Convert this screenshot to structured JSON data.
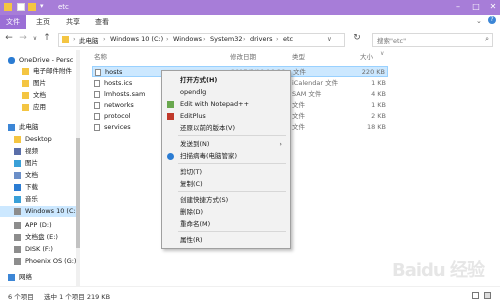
{
  "window": {
    "title": "etc"
  },
  "ribbon": {
    "tabs": [
      "文件",
      "主页",
      "共享",
      "查看"
    ]
  },
  "address": {
    "crumbs": [
      "此电脑",
      "Windows 10 (C:)",
      "Windows",
      "System32",
      "drivers",
      "etc"
    ],
    "search_placeholder": "搜索\"etc\""
  },
  "sidebar": {
    "items": [
      {
        "label": "OneDrive - Persc",
        "icon": "cloud-icon"
      },
      {
        "label": "电子邮件附件",
        "icon": "folder-icon"
      },
      {
        "label": "图片",
        "icon": "folder-icon"
      },
      {
        "label": "文档",
        "icon": "folder-icon"
      },
      {
        "label": "应用",
        "icon": "folder-icon"
      },
      {
        "label": "此电脑",
        "icon": "computer-icon"
      },
      {
        "label": "Desktop",
        "icon": "folder-icon"
      },
      {
        "label": "视频",
        "icon": "video-icon"
      },
      {
        "label": "图片",
        "icon": "image-icon"
      },
      {
        "label": "文档",
        "icon": "document-icon"
      },
      {
        "label": "下载",
        "icon": "download-icon"
      },
      {
        "label": "音乐",
        "icon": "music-icon"
      },
      {
        "label": "Windows 10 (C:)",
        "icon": "drive-icon"
      },
      {
        "label": "APP (D:)",
        "icon": "drive-icon"
      },
      {
        "label": "文档盘 (E:)",
        "icon": "drive-icon"
      },
      {
        "label": "DISK (F:)",
        "icon": "drive-icon"
      },
      {
        "label": "Phoenix OS (G:)",
        "icon": "drive-icon"
      },
      {
        "label": "网络",
        "icon": "network-icon"
      }
    ]
  },
  "columns": {
    "name": "名称",
    "date": "修改日期",
    "type": "类型",
    "size": "大小"
  },
  "files": [
    {
      "name": "hosts",
      "date": "2017/5/19 16:36",
      "type": "文件",
      "size": "220 KB"
    },
    {
      "name": "hosts.ics",
      "date": "",
      "type": "iCalendar 文件",
      "size": "1 KB"
    },
    {
      "name": "lmhosts.sam",
      "date": "",
      "type": "SAM 文件",
      "size": "4 KB"
    },
    {
      "name": "networks",
      "date": "",
      "type": "文件",
      "size": "1 KB"
    },
    {
      "name": "protocol",
      "date": "",
      "type": "文件",
      "size": "2 KB"
    },
    {
      "name": "services",
      "date": "",
      "type": "文件",
      "size": "18 KB"
    }
  ],
  "context_menu": {
    "items": [
      {
        "label": "打开方式(H)",
        "bold": true
      },
      {
        "label": "opendlg"
      },
      {
        "label": "Edit with Notepad++",
        "icon": "notepadpp-icon"
      },
      {
        "label": "EditPlus",
        "icon": "editplus-icon"
      },
      {
        "label": "还原以前的版本(V)"
      },
      {
        "label": "发送到(N)",
        "submenu": true
      },
      {
        "label": "扫描病毒(电脑管家)",
        "icon": "shield-icon"
      },
      {
        "label": "剪切(T)"
      },
      {
        "label": "复制(C)"
      },
      {
        "label": "创建快捷方式(S)"
      },
      {
        "label": "删除(D)"
      },
      {
        "label": "重命名(M)"
      },
      {
        "label": "属性(R)"
      }
    ]
  },
  "status": {
    "count": "6 个项目",
    "selected": "选中 1 个项目 219 KB"
  },
  "watermark": "Baidu 经验",
  "colors": {
    "titlebar": "#a77dd8",
    "file_tab": "#9b6fd6",
    "selection": "#cce8ff"
  }
}
